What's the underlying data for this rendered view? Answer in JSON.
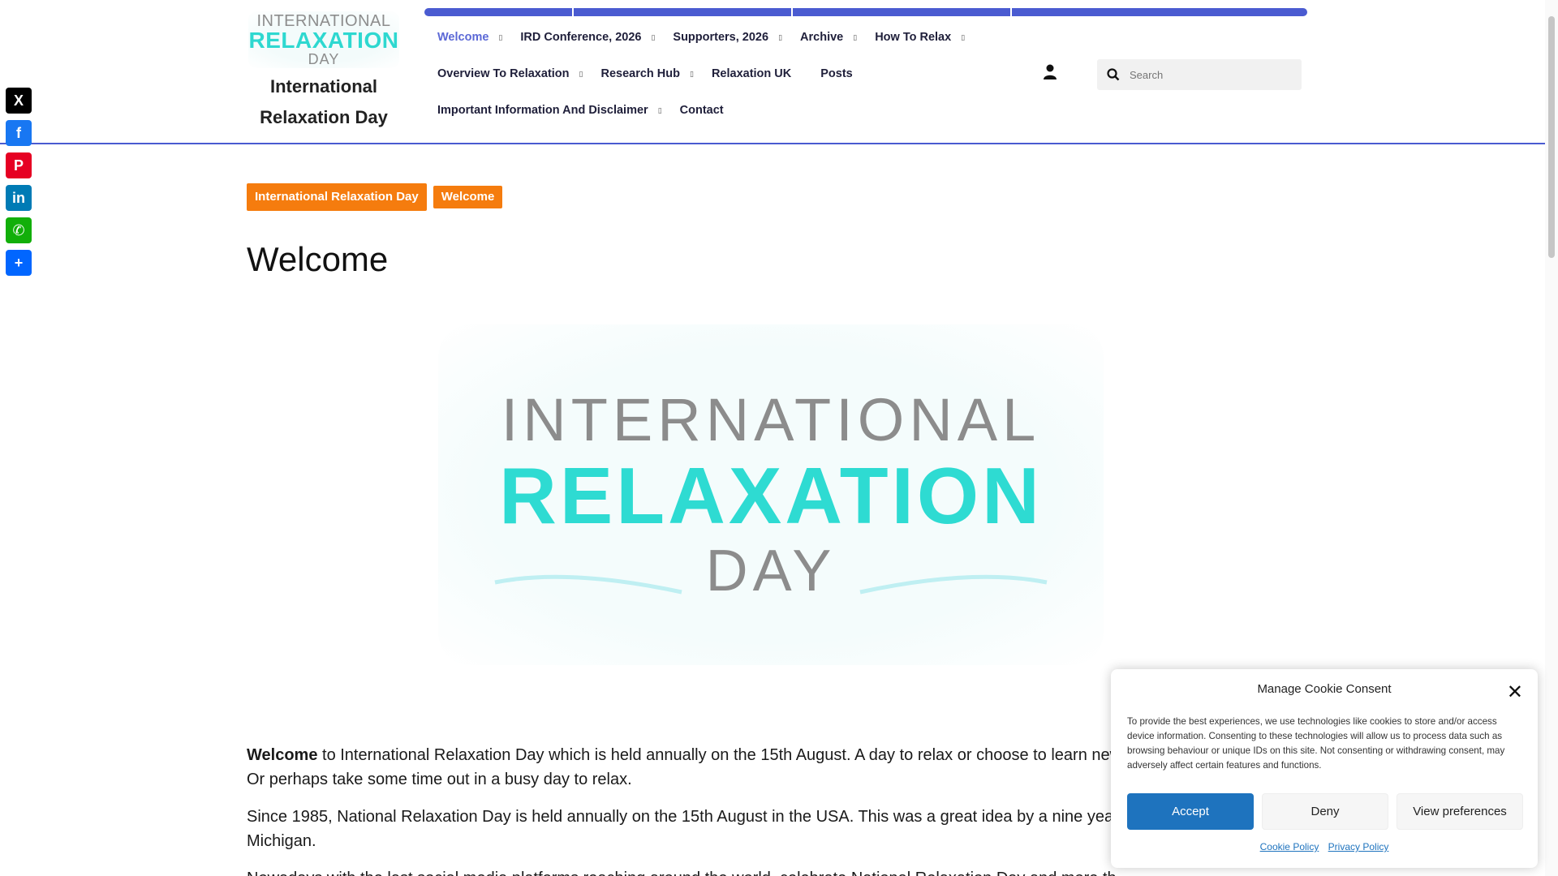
{
  "site": {
    "logo": {
      "line1": "INTERNATIONAL",
      "line2": "RELAXATION",
      "line3": "DAY"
    },
    "title": "International Relaxation Day"
  },
  "nav": {
    "row1": [
      {
        "label": "Welcome",
        "caret": true,
        "active": true
      },
      {
        "label": "IRD Conference, 2026",
        "caret": true
      },
      {
        "label": "Supporters, 2026",
        "caret": true
      },
      {
        "label": "Archive",
        "caret": true
      },
      {
        "label": "How To Relax",
        "caret": true
      }
    ],
    "row2": [
      {
        "label": "Overview To Relaxation",
        "caret": true
      },
      {
        "label": "Research Hub",
        "caret": true
      },
      {
        "label": "Relaxation UK",
        "caret": false
      },
      {
        "label": "Posts",
        "caret": false
      }
    ],
    "row3": [
      {
        "label": "Important Information And Disclaimer",
        "caret": true
      },
      {
        "label": "Contact",
        "caret": false
      }
    ]
  },
  "search": {
    "placeholder": "Search"
  },
  "share": [
    {
      "icon": "x-icon",
      "glyph": "X",
      "color": "#000000"
    },
    {
      "icon": "facebook-icon",
      "glyph": "f",
      "color": "#1877f2"
    },
    {
      "icon": "pinterest-icon",
      "glyph": "P",
      "color": "#e60023"
    },
    {
      "icon": "linkedin-icon",
      "glyph": "in",
      "color": "#007bb5"
    },
    {
      "icon": "whatsapp-icon",
      "glyph": "✆",
      "color": "#12af0a"
    },
    {
      "icon": "share-plus-icon",
      "glyph": "+",
      "color": "#0166ff"
    }
  ],
  "breadcrumb": {
    "item1": "International Relaxation Day",
    "item2": "Welcome"
  },
  "page": {
    "title": "Welcome",
    "hero": {
      "line1": "INTERNATIONAL",
      "line2": "RELAXATION",
      "line3": "DAY"
    },
    "para1_bold": "Welcome",
    "para1_rest": " to International Relaxation Day which is held annually on the 15th August. A day to relax or choose to learn new",
    "para1_line2": "Or perhaps take some time out in a busy day to relax.",
    "para2_line1": "Since 1985, National Relaxation Day is held annually on the 15th August in the USA.  This was a great idea by a nine yea",
    "para2_line2": "Michigan.",
    "para3_line1": "Nowadays with the last social media platforms reaching around the world, celebrate National Relaxation Day and more th"
  },
  "cookie": {
    "title": "Manage Cookie Consent",
    "text": "To provide the best experiences, we use technologies like cookies to store and/or access device information. Consenting to these technologies will allow us to process data such as browsing behaviour or unique IDs on this site. Not consenting or withdrawing consent, may adversely affect certain features and functions.",
    "accept": "Accept",
    "deny": "Deny",
    "preferences": "View preferences",
    "cookie_policy": "Cookie Policy",
    "privacy_policy": "Privacy Policy"
  },
  "colors": {
    "accent": "#4a5bd1",
    "active_nav": "#5b68d6",
    "breadcrumb": "#f57c0e",
    "logo_teal": "#2edbd2",
    "accept_button": "#1e73be"
  }
}
